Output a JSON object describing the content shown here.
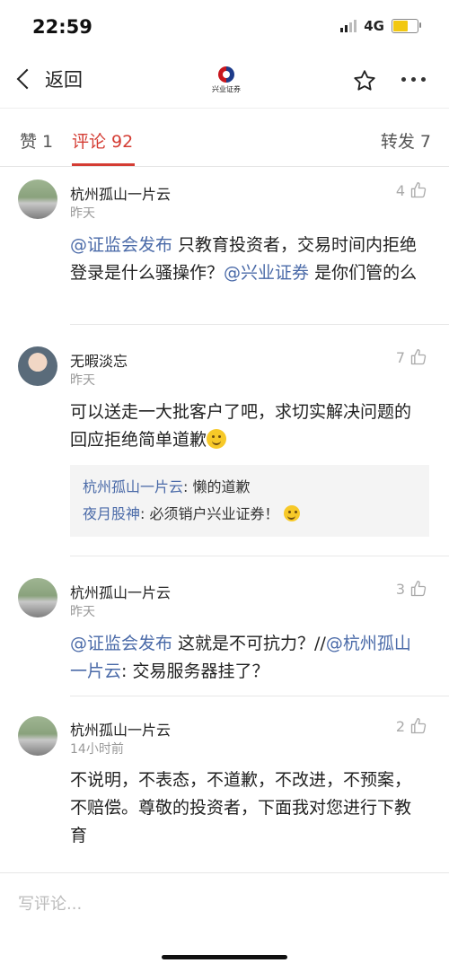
{
  "status_bar": {
    "time": "22:59",
    "network": "4G"
  },
  "nav": {
    "back_label": "返回",
    "logo_text": "兴业证券"
  },
  "tabs": {
    "likes": "赞 1",
    "comments": "评论 92",
    "reposts": "转发 7"
  },
  "comments": [
    {
      "author": "杭州孤山一片云",
      "time": "昨天",
      "likes": "4",
      "parts": [
        "@证监会发布",
        " 只教育投资者，交易时间内拒绝登录是什么骚操作？",
        "@兴业证券",
        " 是你们管的么"
      ]
    },
    {
      "author": "无暇淡忘",
      "time": "昨天",
      "likes": "7",
      "text": "可以送走一大批客户了吧，求切实解决问题的回应拒绝简单道歉",
      "replies": [
        {
          "name": "杭州孤山一片云",
          "text": ": 懒的道歉"
        },
        {
          "name": "夜月股神",
          "text": ": 必须销户兴业证券！"
        }
      ]
    },
    {
      "author": "杭州孤山一片云",
      "time": "昨天",
      "likes": "3",
      "parts": [
        "@证监会发布",
        " 这就是不可抗力？//",
        "@杭州孤山一片云",
        ": 交易服务器挂了？"
      ]
    },
    {
      "author": "杭州孤山一片云",
      "time": "14小时前",
      "likes": "2",
      "text": "不说明，不表态，不道歉，不改进，不预案，不赔偿。尊敬的投资者，下面我对您进行下教育"
    }
  ],
  "bottom": {
    "placeholder": "写评论..."
  },
  "colors": {
    "accent": "#d43c33",
    "mention": "#4a6aa8"
  }
}
